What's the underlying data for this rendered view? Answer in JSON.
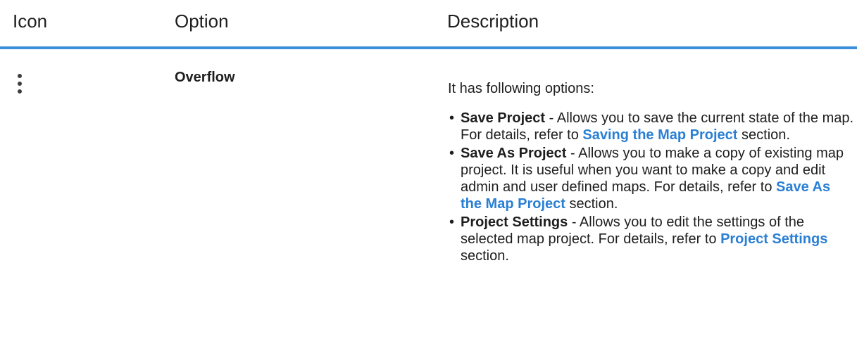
{
  "header": {
    "col_icon": "Icon",
    "col_option": "Option",
    "col_description": "Description"
  },
  "row": {
    "icon": "kebab-menu-icon",
    "option": "Overflow",
    "intro": "It has following options:",
    "items": [
      {
        "term": "Save Project",
        "text_a": " - Allows you to save the current state of the map. For details, refer to ",
        "link": "Saving the Map Project",
        "text_b": " section."
      },
      {
        "term": "Save As Project",
        "text_a": " - Allows you to make a copy of existing map project. It is useful when you want to make a copy and edit admin and user defined maps. For details, refer to ",
        "link": "Save As the Map Project",
        "text_b": " section."
      },
      {
        "term": "Project Settings",
        "text_a": " - Allows you to edit the settings of the selected map project. For details, refer to ",
        "link": "Project Settings",
        "text_b": " section."
      }
    ]
  },
  "colors": {
    "header_rule": "#3a8fdb",
    "link": "#2a7fd4",
    "text": "#1e1e1e"
  }
}
